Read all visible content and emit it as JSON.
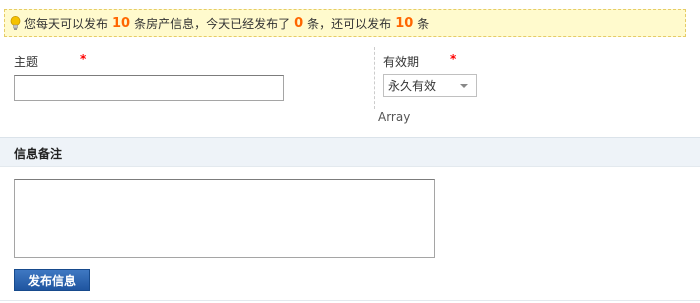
{
  "notice": {
    "icon": "lightbulb-icon",
    "part1": "您每天可以发布",
    "daily_limit": "10",
    "part2": "条房产信息，今天已经发布了",
    "published_today": "0",
    "part3": "条，还可以发布",
    "remaining": "10",
    "part4": "条"
  },
  "form": {
    "subject_label": "主题",
    "subject_value": "",
    "validity_label": "有效期",
    "validity_selected": "永久有效",
    "required_mark": "*",
    "array_text": "Array"
  },
  "remarks": {
    "section_title": "信息备注",
    "textarea_value": ""
  },
  "submit": {
    "label": "发布信息"
  },
  "colors": {
    "notice_bg": "#fffacd",
    "accent_number": "#ff6600",
    "required": "#ff0000",
    "button": "#2a63ae",
    "section_bg": "#eef3f8"
  }
}
